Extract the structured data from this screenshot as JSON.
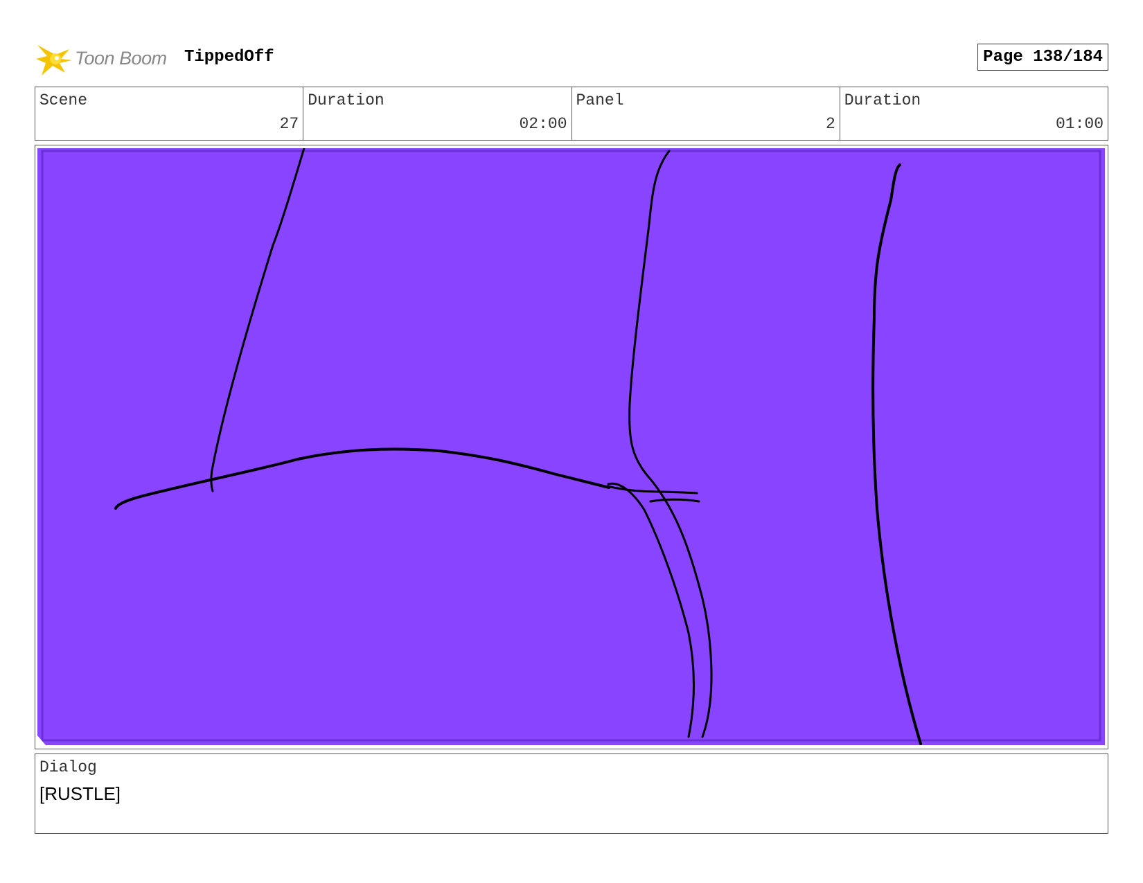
{
  "header": {
    "logo_text": "Toon Boom",
    "project_title": "TippedOff",
    "page_label": "Page 138/184"
  },
  "info": [
    {
      "label": "Scene",
      "value": "27"
    },
    {
      "label": "Duration",
      "value": "02:00"
    },
    {
      "label": "Panel",
      "value": "2"
    },
    {
      "label": "Duration",
      "value": "01:00"
    }
  ],
  "panel": {
    "background_color": "#8844ff",
    "border_color": "#6a2fd6",
    "stroke_color": "#000000"
  },
  "dialog": {
    "label": "Dialog",
    "text": "[RUSTLE]"
  },
  "icons": {
    "logo": "toon-boom-star-icon"
  },
  "colors": {
    "logo_yellow": "#f5c400",
    "logo_text_gray": "#888888"
  }
}
